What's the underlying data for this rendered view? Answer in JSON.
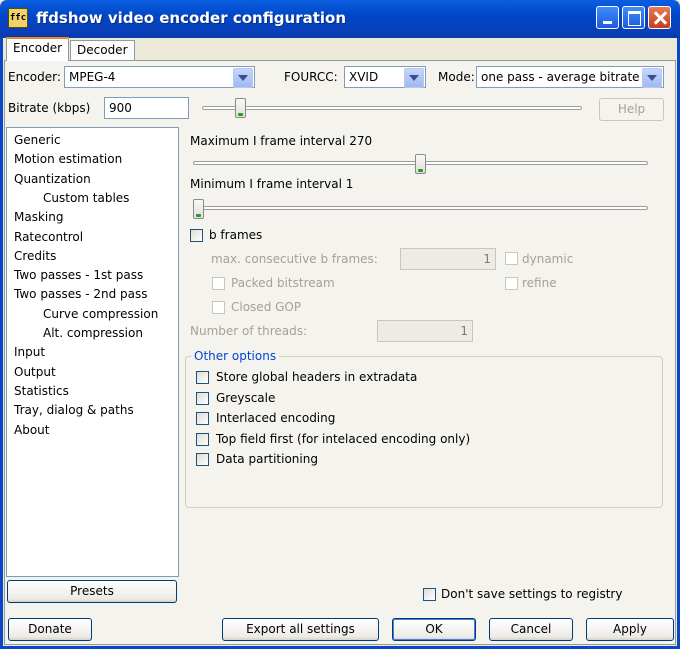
{
  "window": {
    "title": "ffdshow video encoder configuration",
    "app_icon": "ffc"
  },
  "tabs": [
    "Encoder",
    "Decoder"
  ],
  "encoder_row": {
    "encoder_label": "Encoder:",
    "encoder_value": "MPEG-4",
    "fourcc_label": "FOURCC:",
    "fourcc_value": "XVID",
    "mode_label": "Mode:",
    "mode_value": "one pass - average bitrate"
  },
  "bitrate": {
    "label": "Bitrate (kbps)",
    "value": "900",
    "slider_fraction": 0.1
  },
  "help_label": "Help",
  "sidebar": {
    "items": [
      {
        "label": "Generic",
        "sub": false
      },
      {
        "label": "Motion estimation",
        "sub": false
      },
      {
        "label": "Quantization",
        "sub": false
      },
      {
        "label": "Custom tables",
        "sub": true
      },
      {
        "label": "Masking",
        "sub": false
      },
      {
        "label": "Ratecontrol",
        "sub": false
      },
      {
        "label": "Credits",
        "sub": false
      },
      {
        "label": "Two passes - 1st pass",
        "sub": false
      },
      {
        "label": "Two passes - 2nd pass",
        "sub": false
      },
      {
        "label": "Curve compression",
        "sub": true
      },
      {
        "label": "Alt. compression",
        "sub": true
      },
      {
        "label": "Input",
        "sub": false
      },
      {
        "label": "Output",
        "sub": false
      },
      {
        "label": "Statistics",
        "sub": false
      },
      {
        "label": "Tray, dialog & paths",
        "sub": false
      },
      {
        "label": "About",
        "sub": false
      }
    ]
  },
  "generic": {
    "max_i_label": "Maximum I frame interval 270",
    "max_i_fraction": 0.5,
    "min_i_label": "Minimum I frame interval 1",
    "min_i_fraction": 0.0,
    "b_frames_label": "b frames",
    "max_b_label": "max. consecutive b frames:",
    "max_b_value": "1",
    "dynamic_label": "dynamic",
    "packed_label": "Packed bitstream",
    "refine_label": "refine",
    "closed_gop_label": "Closed GOP",
    "threads_label": "Number of threads:",
    "threads_value": "1",
    "other_options_label": "Other options",
    "options": [
      "Store global headers in extradata",
      "Greyscale",
      "Interlaced encoding",
      "Top field first (for intelaced encoding only)",
      "Data partitioning"
    ]
  },
  "presets_label": "Presets",
  "dont_save_label": "Don't save settings to registry",
  "bottom": {
    "donate": "Donate",
    "export": "Export all settings",
    "ok": "OK",
    "cancel": "Cancel",
    "apply": "Apply"
  }
}
